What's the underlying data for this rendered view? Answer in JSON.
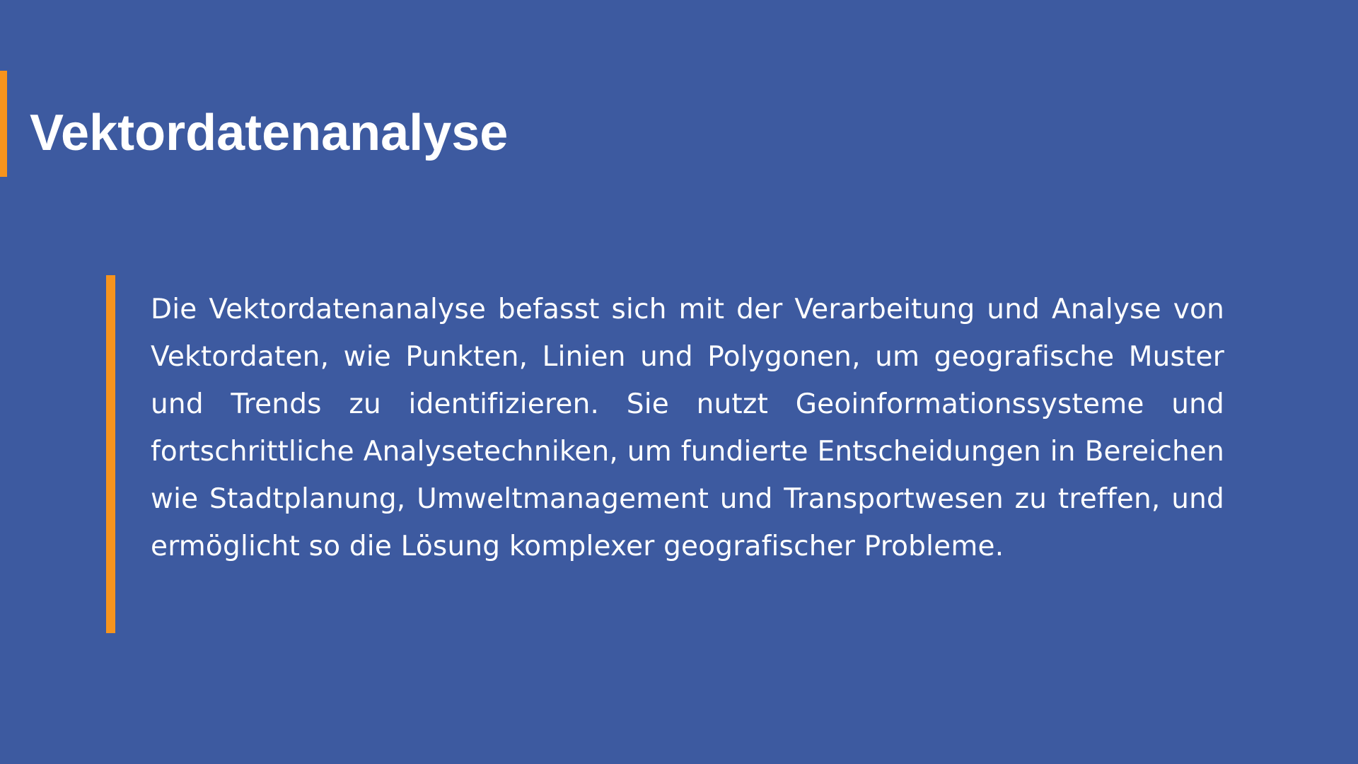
{
  "slide": {
    "title": "Vektordatenanalyse",
    "body": "Die Vektordatenanalyse befasst sich mit der Verarbeitung und Analyse von Vektordaten, wie Punkten, Linien und Polygonen, um geografische Muster und Trends zu identifizieren. Sie nutzt Geoinformationssysteme und fortschrittliche Analysetechniken, um fundierte Entscheidungen in Bereichen wie Stadtplanung, Umweltmanagement und Transportwesen zu treffen, und ermöglicht so die Lösung komplexer geografischer Probleme."
  },
  "colors": {
    "background": "#3d5aa0",
    "accent": "#f7941d",
    "text": "#ffffff"
  }
}
